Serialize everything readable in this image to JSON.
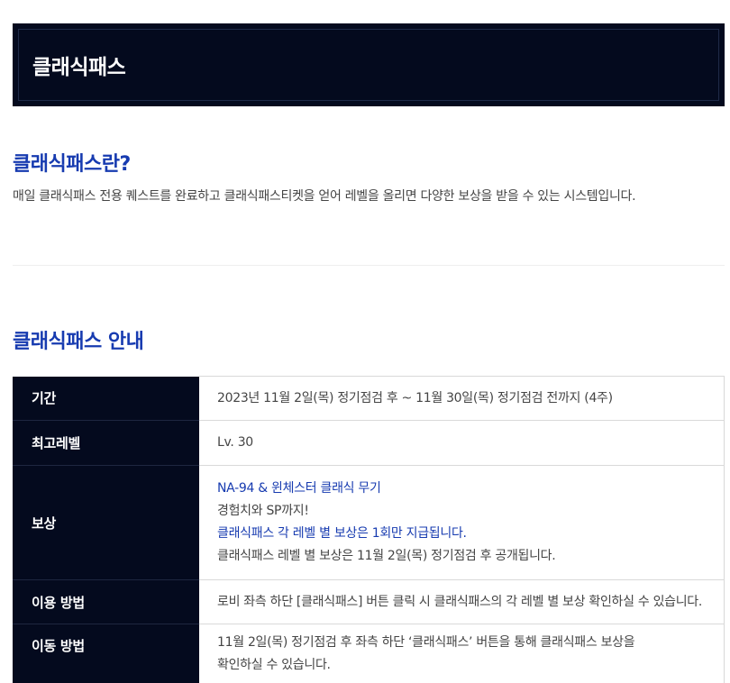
{
  "banner": {
    "title": "클래식패스"
  },
  "intro": {
    "heading": "클래식패스란?",
    "text": "매일 클래식패스 전용 퀘스트를 완료하고 클래식패스티켓을 얻어 레벨을 올리면 다양한 보상을 받을 수 있는 시스템입니다."
  },
  "guide": {
    "heading": "클래식패스 안내",
    "rows": {
      "period": {
        "label": "기간",
        "value": "2023년 11월 2일(목) 정기점검 후 ~ 11월 30일(목) 정기점검 전까지 (4주)"
      },
      "max_level": {
        "label": "최고레벨",
        "value": "Lv. 30"
      },
      "reward": {
        "label": "보상",
        "lines": [
          "NA-94 & 윈체스터 클래식 무기",
          "경험치와 SP까지!",
          "클래식패스 각 레벨 별 보상은 1회만 지급됩니다.",
          "클래식패스 레벨 별 보상은 11월 2일(목) 정기점검 후 공개됩니다."
        ]
      },
      "usage": {
        "label": "이용 방법",
        "value": "로비 좌측 하단 [클래식패스] 버튼 클릭 시 클래식패스의 각 레벨 별 보상 확인하실 수 있습니다."
      },
      "move": {
        "label": "이동 방법",
        "lines": [
          "11월 2일(목) 정기점검 후 좌측 하단 ‘클래식패스’ 버튼을 통해 클래식패스 보상을",
          "확인하실 수 있습니다."
        ]
      }
    }
  },
  "colors": {
    "navy": "#040a1e",
    "accent_blue": "#173bb0",
    "body_text": "#444444",
    "border": "#d9d9d9"
  }
}
